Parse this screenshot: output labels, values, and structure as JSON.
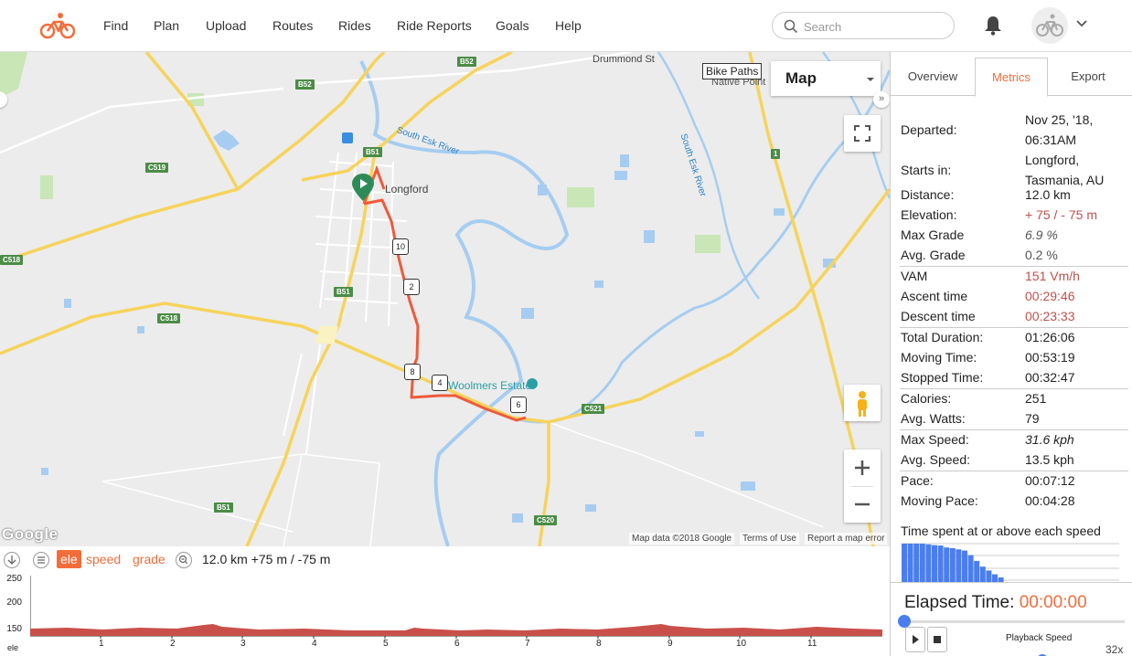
{
  "nav": {
    "items": [
      "Find",
      "Plan",
      "Upload",
      "Routes",
      "Rides",
      "Ride Reports",
      "Goals",
      "Help"
    ],
    "search_placeholder": "Search"
  },
  "map": {
    "bike_paths_label": "Bike Paths",
    "map_type": "Map",
    "attribution": {
      "data": "Map data ©2018 Google",
      "terms": "Terms of Use",
      "report": "Report a map error"
    },
    "google_logo": "Google",
    "places": [
      "Longford",
      "Drummond St",
      "Native Point",
      "Woolmers Estate"
    ],
    "rivers": [
      "South Esk River",
      "South Esk River"
    ],
    "roads": [
      "B52",
      "B52",
      "B51",
      "B51",
      "B51",
      "C519",
      "C518",
      "C518",
      "C521",
      "C520",
      "1"
    ],
    "markers": [
      "10",
      "2",
      "8",
      "4",
      "6"
    ]
  },
  "elevation": {
    "tabs": {
      "ele": "ele",
      "speed": "speed",
      "grade": "grade"
    },
    "summary": "12.0 km +75 m / -75 m",
    "y_ticks": [
      "250",
      "200",
      "150"
    ],
    "x_ticks": [
      "1",
      "2",
      "3",
      "4",
      "5",
      "6",
      "7",
      "8",
      "9",
      "10",
      "11"
    ],
    "y_axis_label": "ele"
  },
  "panel": {
    "tabs": [
      "Overview",
      "Metrics",
      "Export"
    ],
    "active_tab": "Metrics",
    "metrics": {
      "departed": {
        "k": "Departed:",
        "v1": "Nov 25, '18,",
        "v2": "06:31AM"
      },
      "starts": {
        "k": "Starts in:",
        "v1": "Longford,",
        "v2": "Tasmania, AU"
      },
      "distance": {
        "k": "Distance:",
        "v": "12.0 km"
      },
      "elevation": {
        "k": "Elevation:",
        "v": "+ 75 / - 75 m"
      },
      "max_grade": {
        "k": "Max Grade",
        "v": "6.9 %"
      },
      "avg_grade": {
        "k": "Avg. Grade",
        "v": "0.2 %"
      },
      "vam": {
        "k": "VAM",
        "v": "151 Vm/h"
      },
      "ascent": {
        "k": "Ascent time",
        "v": "00:29:46"
      },
      "descent": {
        "k": "Descent time",
        "v": "00:23:33"
      },
      "total_duration": {
        "k": "Total Duration:",
        "v": "01:26:06"
      },
      "moving_time": {
        "k": "Moving Time:",
        "v": "00:53:19"
      },
      "stopped_time": {
        "k": "Stopped Time:",
        "v": "00:32:47"
      },
      "calories": {
        "k": "Calories:",
        "v": "251"
      },
      "avg_watts": {
        "k": "Avg. Watts:",
        "v": "79"
      },
      "max_speed": {
        "k": "Max Speed:",
        "v": "31.6 kph"
      },
      "avg_speed": {
        "k": "Avg. Speed:",
        "v": "13.5 kph"
      },
      "pace": {
        "k": "Pace:",
        "v": "00:07:12"
      },
      "moving_pace": {
        "k": "Moving Pace:",
        "v": "00:04:28"
      }
    },
    "speed_chart_title": "Time spent at or above each speed",
    "speed_bars": [
      1.0,
      1.0,
      1.0,
      1.0,
      0.98,
      0.96,
      0.95,
      0.9,
      0.88,
      0.85,
      0.82,
      0.7,
      0.55,
      0.4,
      0.3,
      0.2,
      0.12
    ],
    "elapsed_label": "Elapsed Time:",
    "elapsed_value": "00:00:00",
    "playback_label": "Playback Speed",
    "playback_speed": "32x"
  },
  "colors": {
    "accent": "#f36c3a",
    "route": "#f05a3c",
    "value_red": "#c0504d",
    "water": "#a6cdf1",
    "road": "#f6d35c",
    "park": "#c8e6b6"
  }
}
